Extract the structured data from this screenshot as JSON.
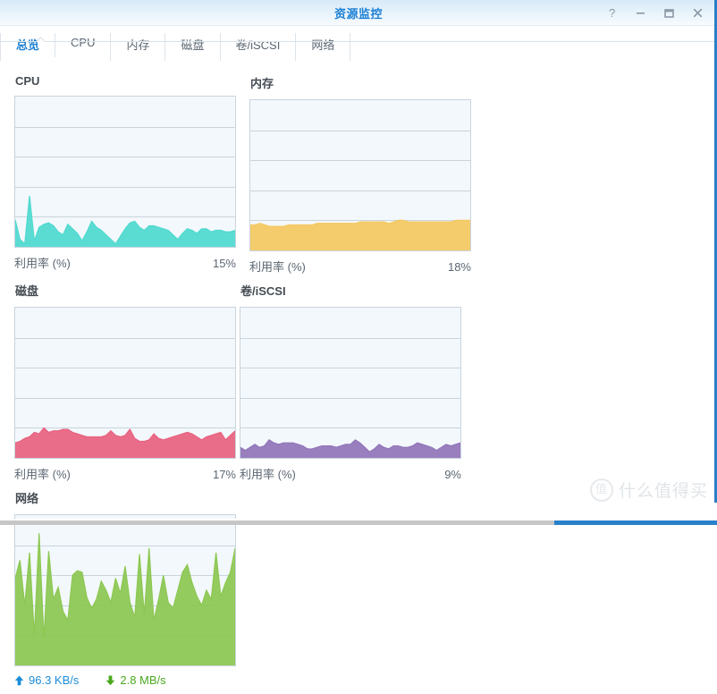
{
  "window": {
    "title": "资源监控",
    "controls": [
      {
        "name": "help-button",
        "glyph": "?"
      },
      {
        "name": "minimize-button",
        "glyph": "−"
      },
      {
        "name": "maximize-button",
        "glyph": "□"
      },
      {
        "name": "close-button",
        "glyph": "✕"
      }
    ]
  },
  "tabs": [
    {
      "label": "总览",
      "active": true
    },
    {
      "label": "CPU",
      "active": false
    },
    {
      "label": "内存",
      "active": false
    },
    {
      "label": "磁盘",
      "active": false
    },
    {
      "label": "卷/iSCSI",
      "active": false
    },
    {
      "label": "网络",
      "active": false
    }
  ],
  "panels": {
    "cpu": {
      "title": "CPU",
      "metric_label": "利用率 (%)",
      "value": "15%",
      "color": "#4ed9cf"
    },
    "memory": {
      "title": "内存",
      "metric_label": "利用率 (%)",
      "value": "18%",
      "color": "#f5c85f"
    },
    "disk": {
      "title": "磁盘",
      "metric_label": "利用率 (%)",
      "value": "17%",
      "color": "#e8617f"
    },
    "volume": {
      "title": "卷/iSCSI",
      "metric_label": "利用率 (%)",
      "value": "9%",
      "color": "#9174b9"
    },
    "network": {
      "title": "网络",
      "color": "#8cc košt",
      "upload": {
        "icon": "arrow-up-icon",
        "value": "96.3 KB/s",
        "color": "#1b8cd8"
      },
      "download": {
        "icon": "arrow-down-icon",
        "value": "2.8 MB/s",
        "color": "#4aa81e"
      }
    }
  },
  "watermark": {
    "logo": "值",
    "text": "什么值得买"
  },
  "chart_data": [
    {
      "type": "area",
      "id": "cpu",
      "title": "CPU",
      "ylabel": "利用率 (%)",
      "current_value": 15,
      "ylim": [
        0,
        100
      ],
      "grid": true,
      "gridlines": [
        20,
        40,
        60,
        80
      ],
      "color": "#4ed9cf",
      "values": [
        18,
        5,
        2,
        34,
        4,
        13,
        15,
        16,
        14,
        10,
        8,
        15,
        12,
        9,
        4,
        10,
        17,
        13,
        11,
        8,
        5,
        2,
        7,
        12,
        16,
        17,
        13,
        11,
        14,
        14,
        13,
        12,
        11,
        8,
        5,
        9,
        12,
        11,
        9,
        12,
        12,
        10,
        11,
        11,
        10,
        10,
        11
      ]
    },
    {
      "type": "area",
      "id": "memory",
      "title": "内存",
      "ylabel": "利用率 (%)",
      "current_value": 18,
      "ylim": [
        0,
        100
      ],
      "grid": true,
      "gridlines": [
        20,
        40,
        60,
        80
      ],
      "color": "#f5c85f",
      "values": [
        17,
        17,
        18,
        17,
        16,
        16,
        16,
        16,
        17,
        17,
        17,
        17,
        17,
        17,
        18,
        18,
        18,
        18,
        18,
        18,
        18,
        18,
        18,
        19,
        19,
        19,
        19,
        19,
        19,
        18,
        19,
        20,
        20,
        19,
        19,
        19,
        19,
        19,
        19,
        19,
        19,
        19,
        19,
        20,
        20,
        20,
        20
      ]
    },
    {
      "type": "area",
      "id": "disk",
      "title": "磁盘",
      "ylabel": "利用率 (%)",
      "current_value": 17,
      "ylim": [
        0,
        100
      ],
      "grid": true,
      "gridlines": [
        20,
        40,
        60,
        80
      ],
      "color": "#e8617f",
      "values": [
        10,
        11,
        13,
        14,
        17,
        16,
        20,
        17,
        18,
        18,
        19,
        19,
        17,
        16,
        15,
        14,
        14,
        14,
        14,
        15,
        18,
        15,
        14,
        15,
        19,
        13,
        11,
        11,
        12,
        16,
        13,
        12,
        13,
        14,
        15,
        16,
        17,
        16,
        14,
        12,
        14,
        15,
        16,
        17,
        12,
        15,
        18
      ]
    },
    {
      "type": "area",
      "id": "volume",
      "title": "卷/iSCSI",
      "ylabel": "利用率 (%)",
      "current_value": 9,
      "ylim": [
        0,
        100
      ],
      "grid": true,
      "gridlines": [
        20,
        40,
        60,
        80
      ],
      "color": "#9174b9",
      "values": [
        7,
        5,
        7,
        9,
        7,
        8,
        12,
        10,
        9,
        10,
        10,
        10,
        9,
        8,
        6,
        6,
        7,
        8,
        8,
        8,
        7,
        8,
        9,
        9,
        12,
        10,
        7,
        4,
        6,
        9,
        7,
        6,
        8,
        8,
        7,
        7,
        8,
        10,
        9,
        8,
        7,
        5,
        7,
        9,
        8,
        9,
        10
      ]
    },
    {
      "type": "area",
      "id": "network",
      "title": "网络",
      "grid": true,
      "gridlines": [
        20,
        40,
        60,
        80
      ],
      "color": "#8cc751",
      "upload_label": "96.3 KB/s",
      "download_label": "2.8 MB/s",
      "values": [
        58,
        70,
        40,
        75,
        20,
        88,
        18,
        76,
        44,
        52,
        36,
        30,
        60,
        63,
        62,
        45,
        38,
        44,
        56,
        50,
        42,
        58,
        48,
        66,
        42,
        32,
        74,
        34,
        78,
        30,
        44,
        60,
        42,
        38,
        50,
        62,
        67,
        55,
        46,
        40,
        50,
        44,
        75,
        46,
        55,
        62,
        78
      ]
    }
  ]
}
